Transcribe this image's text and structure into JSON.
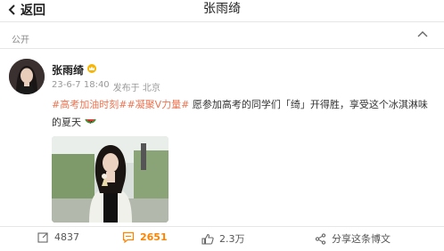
{
  "header": {
    "back_label": "返回",
    "title": "张雨绮"
  },
  "post": {
    "visibility": "公开",
    "author": "张雨绮",
    "date": "23-6-7 18:40",
    "source": "发布于 北京",
    "tags": [
      "#高考加油时刻#",
      "#凝聚V力量#"
    ],
    "body": " 愿参加高考的同学们「绮」开得胜，享受这个冰淇淋味的夏天"
  },
  "actions": {
    "share_count": "4837",
    "comment_count": "2651",
    "like_count": "2.3万",
    "share_label": "分享这条博文"
  },
  "colors": {
    "accent": "#ff8200",
    "tag": "#eb7350"
  }
}
